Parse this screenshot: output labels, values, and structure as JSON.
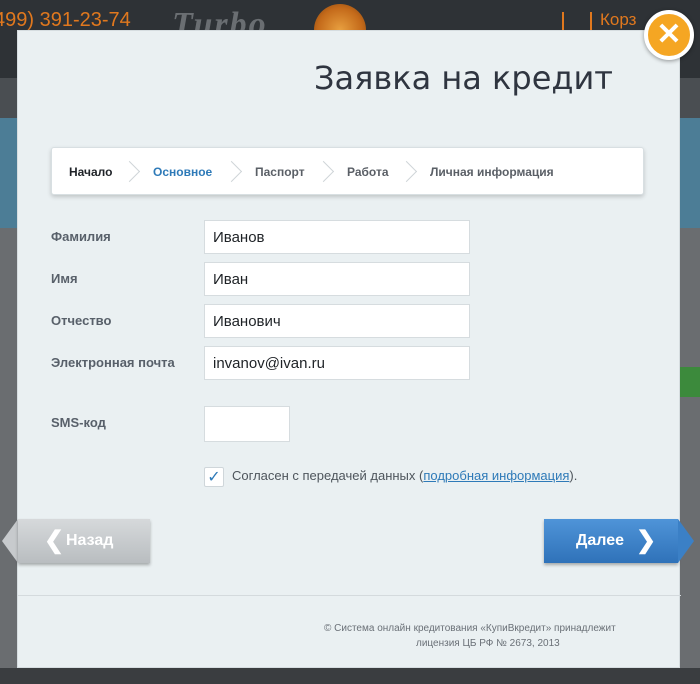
{
  "background": {
    "phone": "499) 391-23-74",
    "logo": "Turbo ... rucor",
    "cart": "Корз"
  },
  "modal": {
    "title": "Заявка на кредит",
    "steps": [
      {
        "label": "Начало"
      },
      {
        "label": "Основное"
      },
      {
        "label": "Паспорт"
      },
      {
        "label": "Работа"
      },
      {
        "label": "Личная информация"
      }
    ],
    "fields": {
      "last_name": {
        "label": "Фамилия",
        "value": "Иванов"
      },
      "first_name": {
        "label": "Имя",
        "value": "Иван"
      },
      "patronymic": {
        "label": "Отчество",
        "value": "Иванович"
      },
      "email": {
        "label": "Электронная почта",
        "value": "invanov@ivan.ru"
      },
      "sms": {
        "label": "SMS-код",
        "value": ""
      }
    },
    "agreement": {
      "checked": true,
      "text": "Согласен с передачей данных (",
      "link": "подробная информация",
      "suffix": ")."
    },
    "buttons": {
      "back": "Назад",
      "next": "Далее"
    },
    "footer": {
      "line1": "© Система онлайн кредитования «КупиВкредит» принадлежит",
      "line2": "лицензия ЦБ РФ № 2673, 2013"
    },
    "colors": {
      "accent": "#2e7ab8",
      "close": "#f5a623"
    }
  }
}
